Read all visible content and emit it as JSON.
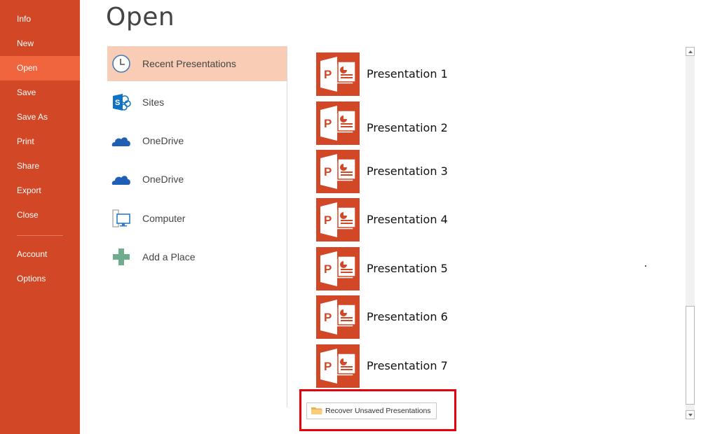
{
  "sidebar": {
    "items": [
      {
        "label": "Info"
      },
      {
        "label": "New"
      },
      {
        "label": "Open",
        "active": true
      },
      {
        "label": "Save"
      },
      {
        "label": "Save As"
      },
      {
        "label": "Print"
      },
      {
        "label": "Share"
      },
      {
        "label": "Export"
      },
      {
        "label": "Close"
      },
      {
        "label": "Account"
      },
      {
        "label": "Options"
      }
    ]
  },
  "header": {
    "title": "Open"
  },
  "places": [
    {
      "label": "Recent Presentations",
      "icon": "clock-icon",
      "active": true
    },
    {
      "label": "Sites",
      "icon": "sharepoint-icon"
    },
    {
      "label": "OneDrive",
      "icon": "onedrive-cloud-icon"
    },
    {
      "label": "OneDrive",
      "icon": "onedrive-cloud-icon"
    },
    {
      "label": "Computer",
      "icon": "computer-icon"
    },
    {
      "label": "Add a Place",
      "icon": "plus-icon"
    }
  ],
  "recent": {
    "items": [
      {
        "name": "Presentation 1"
      },
      {
        "name": "Presentation 2"
      },
      {
        "name": "Presentation 3"
      },
      {
        "name": "Presentation 4"
      },
      {
        "name": "Presentation 5"
      },
      {
        "name": "Presentation 6"
      },
      {
        "name": "Presentation 7"
      }
    ],
    "recover_label": "Recover Unsaved Presentations"
  },
  "colors": {
    "brand": "#d24726",
    "sidebar_active": "#f0643e",
    "place_active": "#f9ccb5",
    "highlight_box": "#e8000b"
  }
}
